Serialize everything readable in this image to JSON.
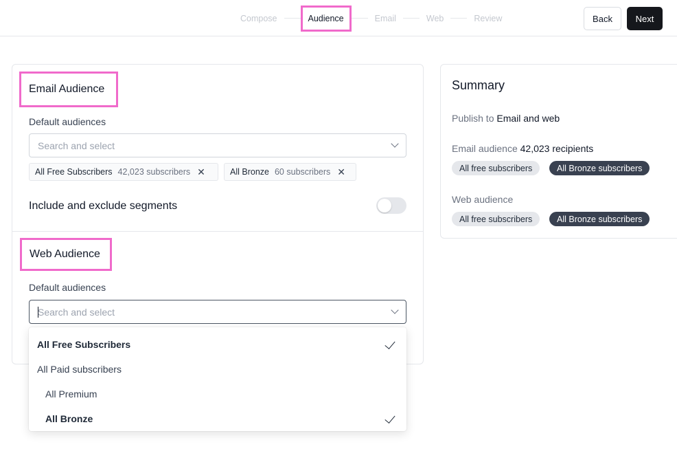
{
  "steps": {
    "compose": "Compose",
    "audience": "Audience",
    "email": "Email",
    "web": "Web",
    "review": "Review"
  },
  "buttons": {
    "back": "Back",
    "next": "Next"
  },
  "email_audience": {
    "heading": "Email Audience",
    "default_label": "Default audiences",
    "placeholder": "Search and select",
    "tags": [
      {
        "name": "All Free Subscribers",
        "count": "42,023 subscribers"
      },
      {
        "name": "All Bronze",
        "count": "60 subscribers"
      }
    ],
    "segments_label": "Include and exclude segments",
    "segments_enabled": false
  },
  "web_audience": {
    "heading": "Web Audience",
    "default_label": "Default audiences",
    "placeholder": "Search and select",
    "options": [
      {
        "label": "All Free Subscribers",
        "selected": true
      },
      {
        "label": "All Paid subscribers",
        "selected": false
      },
      {
        "label": "All Premium",
        "selected": false
      },
      {
        "label": "All Bronze",
        "selected": true
      }
    ]
  },
  "summary": {
    "title": "Summary",
    "publish_prefix": "Publish to",
    "publish_value": "Email and web",
    "email_prefix": "Email audience",
    "email_value": "42,023 recipients",
    "email_pills": [
      "All free subscribers",
      "All Bronze subscribers"
    ],
    "web_label": "Web audience",
    "web_pills": [
      "All free subscribers",
      "All Bronze subscribers"
    ]
  },
  "colors": {
    "highlight": "#f06acb",
    "primary_button": "#15171c",
    "dark_pill": "#394150",
    "light_pill": "#e5e7eb"
  },
  "icons": [
    "chevron-down-icon",
    "close-icon",
    "checkmark-icon"
  ]
}
